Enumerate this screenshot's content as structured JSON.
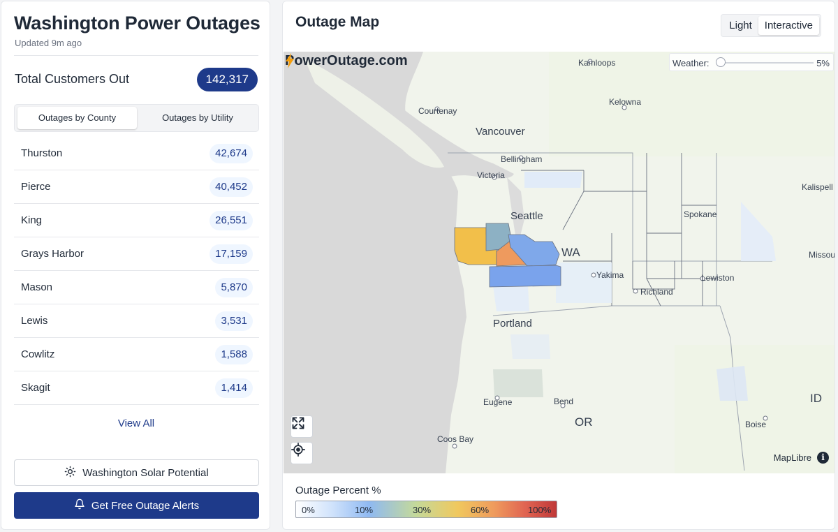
{
  "sidebar": {
    "title": "Washington Power Outages",
    "updated": "Updated 9m ago",
    "total_label": "Total Customers Out",
    "total_value": "142,317",
    "tabs": [
      {
        "label": "Outages by County",
        "active": true
      },
      {
        "label": "Outages by Utility",
        "active": false
      }
    ],
    "counties": [
      {
        "name": "Thurston",
        "count": "42,674"
      },
      {
        "name": "Pierce",
        "count": "40,452"
      },
      {
        "name": "King",
        "count": "26,551"
      },
      {
        "name": "Grays Harbor",
        "count": "17,159"
      },
      {
        "name": "Mason",
        "count": "5,870"
      },
      {
        "name": "Lewis",
        "count": "3,531"
      },
      {
        "name": "Cowlitz",
        "count": "1,588"
      },
      {
        "name": "Skagit",
        "count": "1,414"
      }
    ],
    "view_all": "View All",
    "solar_button": "Washington Solar Potential",
    "alerts_button": "Get Free Outage Alerts"
  },
  "map": {
    "title": "Outage Map",
    "mode_options": [
      "Light",
      "Interactive"
    ],
    "mode_selected": "Interactive",
    "brand": "PowerOutage.com",
    "weather_label": "Weather:",
    "weather_value": "5%",
    "attribution": "MapLibre",
    "info_glyph": "i",
    "labels": {
      "kamloops": "Kamloops",
      "kelowna": "Kelowna",
      "courtenay": "Courtenay",
      "vancouver": "Vancouver",
      "bellingham": "Bellingham",
      "victoria": "Victoria",
      "kalispell": "Kalispell",
      "seattle": "Seattle",
      "spokane": "Spokane",
      "wa": "WA",
      "yakima": "Yakima",
      "missoula": "Missou",
      "lewiston": "Lewiston",
      "richland": "Richland",
      "portland": "Portland",
      "id": "ID",
      "eugene": "Eugene",
      "bend": "Bend",
      "or": "OR",
      "boise": "Boise",
      "coos_bay": "Coos Bay"
    }
  },
  "legend": {
    "title": "Outage Percent %",
    "ticks": [
      "0%",
      "10%",
      "30%",
      "60%",
      "100%"
    ]
  },
  "colors": {
    "primary": "#1e3a8a",
    "ocean": "#d9d9d9",
    "grays_harbor": "#f2bf4a",
    "thurston": "#ee9a5e",
    "pierce": "#7fa8ea",
    "lewis": "#7aa3ec",
    "mason": "#8db1c4"
  }
}
